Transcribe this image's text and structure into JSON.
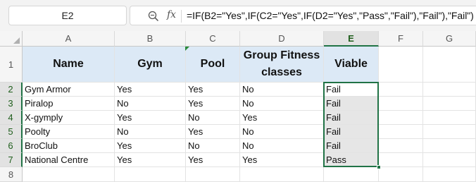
{
  "formula_bar": {
    "cell_ref": "E2",
    "zoom_icon": "zoom-icon",
    "fx_label": "fx",
    "formula": "=IF(B2=\"Yes\",IF(C2=\"Yes\",IF(D2=\"Yes\",\"Pass\",\"Fail\"),\"Fail\"),\"Fail\")"
  },
  "columns": [
    "A",
    "B",
    "C",
    "D",
    "E",
    "F",
    "G"
  ],
  "rows": [
    "1",
    "2",
    "3",
    "4",
    "5",
    "6",
    "7",
    "8"
  ],
  "header": {
    "name": "Name",
    "gym": "Gym",
    "pool": "Pool",
    "group": "Group Fitness classes",
    "viable": "Viable"
  },
  "data": [
    {
      "name": "Gym Armor",
      "gym": "Yes",
      "pool": "Yes",
      "group": "No",
      "viable": "Fail"
    },
    {
      "name": "Piralop",
      "gym": "No",
      "pool": "Yes",
      "group": "No",
      "viable": "Fail"
    },
    {
      "name": "X-gymply",
      "gym": "Yes",
      "pool": "No",
      "group": "Yes",
      "viable": "Fail"
    },
    {
      "name": "Poolty",
      "gym": "No",
      "pool": "Yes",
      "group": "No",
      "viable": "Fail"
    },
    {
      "name": "BroClub",
      "gym": "Yes",
      "pool": "No",
      "group": "No",
      "viable": "Fail"
    },
    {
      "name": "National Centre",
      "gym": "Yes",
      "pool": "Yes",
      "group": "Yes",
      "viable": "Pass"
    }
  ],
  "colors": {
    "header_fill": "#dce9f6",
    "selection_border": "#217346",
    "selected_fill": "#e6e6e6"
  }
}
